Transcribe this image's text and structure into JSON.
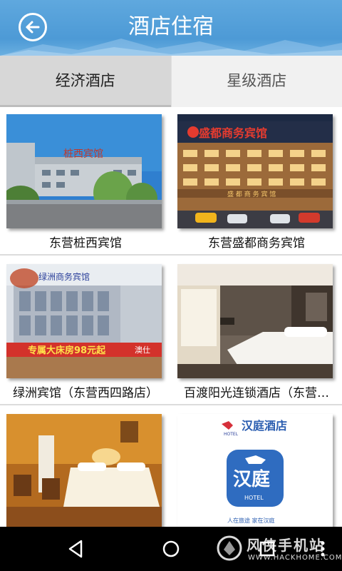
{
  "header": {
    "title": "酒店住宿"
  },
  "tabs": [
    {
      "label": "经济酒店",
      "active": true
    },
    {
      "label": "星级酒店",
      "active": false
    }
  ],
  "hotels": [
    {
      "name": "东营桩西宾馆",
      "photo": "hotel-exterior-photo"
    },
    {
      "name": "东营盛都商务宾馆",
      "photo": "hotel-night-exterior-photo"
    },
    {
      "name": "绿洲宾馆（东营西四路店）",
      "photo": "hotel-storefront-photo"
    },
    {
      "name": "百渡阳光连锁酒店（东营…",
      "photo": "hotel-room-photo"
    },
    {
      "name": "",
      "photo": "hotel-room-warm-photo"
    },
    {
      "name": "",
      "photo": "hanting-hotel-logo"
    }
  ],
  "photo_text": {
    "sign_1": "桩西宾馆",
    "sign_2": "盛都商务宾馆",
    "sign_2_small": "盛 都 商 务 宾 馆",
    "sign_3_top": "绿洲商务宾馆",
    "sign_3_banner": "专属大床房98元起",
    "sign_3_side": "澳仕",
    "hanting_top": "汉庭酒店",
    "hanting_big": "汉庭",
    "hanting_hotel": "HOTEL",
    "hanting_small": "HOTEL",
    "hanting_slogan": "人在旅途  家在汉庭"
  },
  "watermark": {
    "title": "风侠手机站",
    "url": "WWW.HACKHOME.COM"
  },
  "colors": {
    "header": "#4d9ad6",
    "tab_active": "#d7d7d7",
    "tab_inactive": "#f1f1f1",
    "navbar": "#000000"
  }
}
